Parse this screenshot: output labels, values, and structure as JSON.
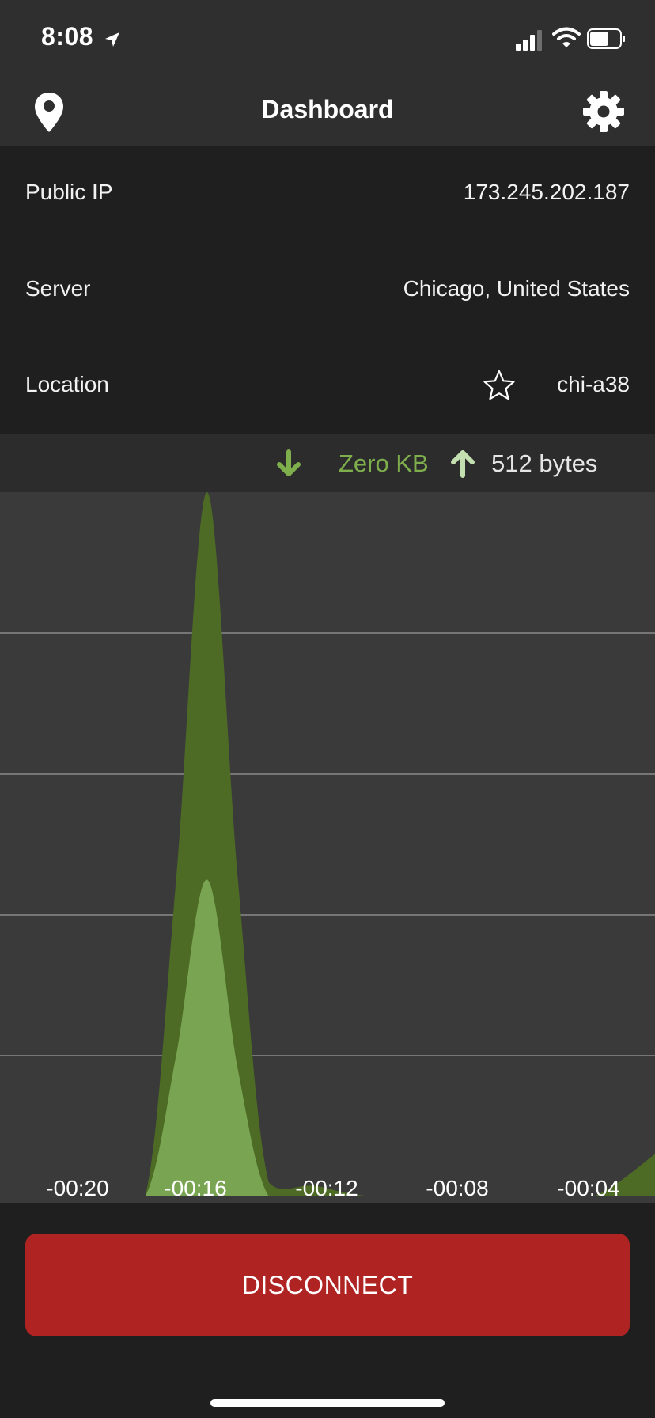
{
  "status_bar": {
    "time": "8:08",
    "icons": [
      "location-arrow-icon",
      "cellular-signal-icon",
      "wifi-icon",
      "battery-icon"
    ]
  },
  "nav": {
    "title": "Dashboard",
    "left_icon": "map-pin-icon",
    "right_icon": "gear-icon"
  },
  "info": {
    "rows": [
      {
        "label": "Public IP",
        "value": "173.245.202.187"
      },
      {
        "label": "Server",
        "value": "Chicago, United States"
      },
      {
        "label": "Location",
        "value": "chi-a38",
        "icon": "star-outline-icon"
      }
    ]
  },
  "legend": {
    "download_value": "Zero KB",
    "upload_value": "512 bytes",
    "download_color": "#7fae4d",
    "upload_color": "#c5e0b0"
  },
  "chart_data": {
    "type": "area",
    "x_tick_labels": [
      "-00:20",
      "-00:16",
      "-00:12",
      "-00:08",
      "-00:04"
    ],
    "x": [
      -20,
      -18,
      -16.5,
      -15.5,
      -14.5,
      -13.5,
      -12.5,
      -11,
      -9,
      -4,
      -2,
      0
    ],
    "series": [
      {
        "values": [
          0,
          0,
          0,
          0.45,
          1.0,
          0.45,
          0.02,
          0.015,
          0,
          0,
          0,
          0.06
        ],
        "color": "#4d6b24"
      },
      {
        "values": [
          0,
          0,
          0,
          0.2,
          0.45,
          0.18,
          0,
          0,
          0,
          0,
          0,
          0
        ],
        "color": "#79a553"
      }
    ],
    "grid": true,
    "grid_line_count": 4,
    "ylim": [
      0,
      1
    ],
    "xlim": [
      -21.2,
      0
    ]
  },
  "actions": {
    "disconnect_label": "DISCONNECT",
    "disconnect_color": "#b02323"
  }
}
